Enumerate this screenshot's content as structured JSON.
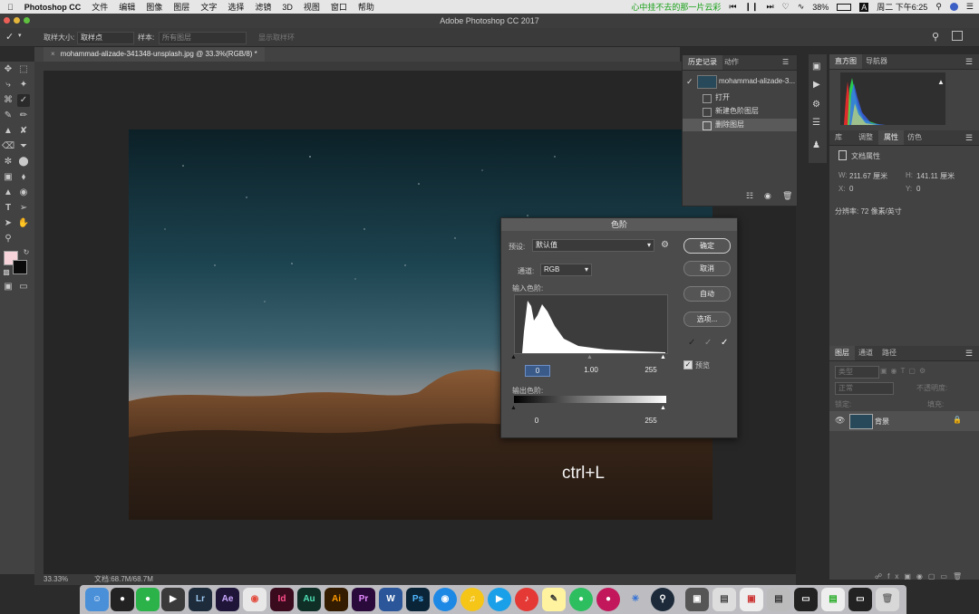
{
  "menubar": {
    "apple": "",
    "app_name": "Photoshop CC",
    "items": [
      "文件",
      "编辑",
      "图像",
      "图层",
      "文字",
      "选择",
      "滤镜",
      "3D",
      "视图",
      "窗口",
      "帮助"
    ],
    "lyric": "心中挂不去的那一片云彩",
    "battery": "38%",
    "clock": "周二 下午6:25"
  },
  "window": {
    "title": "Adobe Photoshop CC 2017"
  },
  "options": {
    "sample_size_label": "取样大小:",
    "sample_size_value": "取样点",
    "sample_label": "样本:",
    "sample_value": "所有图层",
    "show_ring": "显示取样环"
  },
  "document": {
    "tab": "mohammad-alizade-341348-unsplash.jpg @ 33.3%(RGB/8) *",
    "zoom": "33.33%",
    "doc_size": "文档:68.7M/68.7M",
    "overlay_text": "ctrl+L"
  },
  "history_panel": {
    "tabs": [
      "历史记录",
      "动作"
    ],
    "snapshot": "mohammad-alizade-3...",
    "items": [
      "打开",
      "新建色阶图层",
      "删除图层"
    ]
  },
  "histogram_panel": {
    "tabs": [
      "直方图",
      "导航器"
    ]
  },
  "properties_panel": {
    "tabs": [
      "库",
      "调整",
      "属性",
      "仿色"
    ],
    "section": "文档属性",
    "w_label": "W:",
    "w_value": "211.67 厘米",
    "h_label": "H:",
    "h_value": "141.11 厘米",
    "x_label": "X:",
    "x_value": "0",
    "y_label": "Y:",
    "y_value": "0",
    "resolution": "分辨率: 72 像素/英寸"
  },
  "layers_panel": {
    "tabs": [
      "图层",
      "通道",
      "路径"
    ],
    "kind_label": "类型",
    "mode_label": "正常",
    "opacity_label": "不透明度:",
    "lock_label": "锁定:",
    "fill_label": "填充:",
    "layer_name": "背景"
  },
  "levels_dialog": {
    "title": "色阶",
    "preset_label": "预设:",
    "preset_value": "默认值",
    "channel_label": "通道:",
    "channel_value": "RGB",
    "input_label": "输入色阶:",
    "input_black": "0",
    "input_gamma": "1.00",
    "input_white": "255",
    "output_label": "输出色阶:",
    "output_black": "0",
    "output_white": "255",
    "ok": "确定",
    "cancel": "取消",
    "auto": "自动",
    "options": "选项...",
    "preview_label": "预览",
    "preview_checked": true
  },
  "dock_apps": [
    "Lr",
    "Ae",
    "Id",
    "Au",
    "Ai",
    "Pr",
    "W",
    "Ps"
  ]
}
